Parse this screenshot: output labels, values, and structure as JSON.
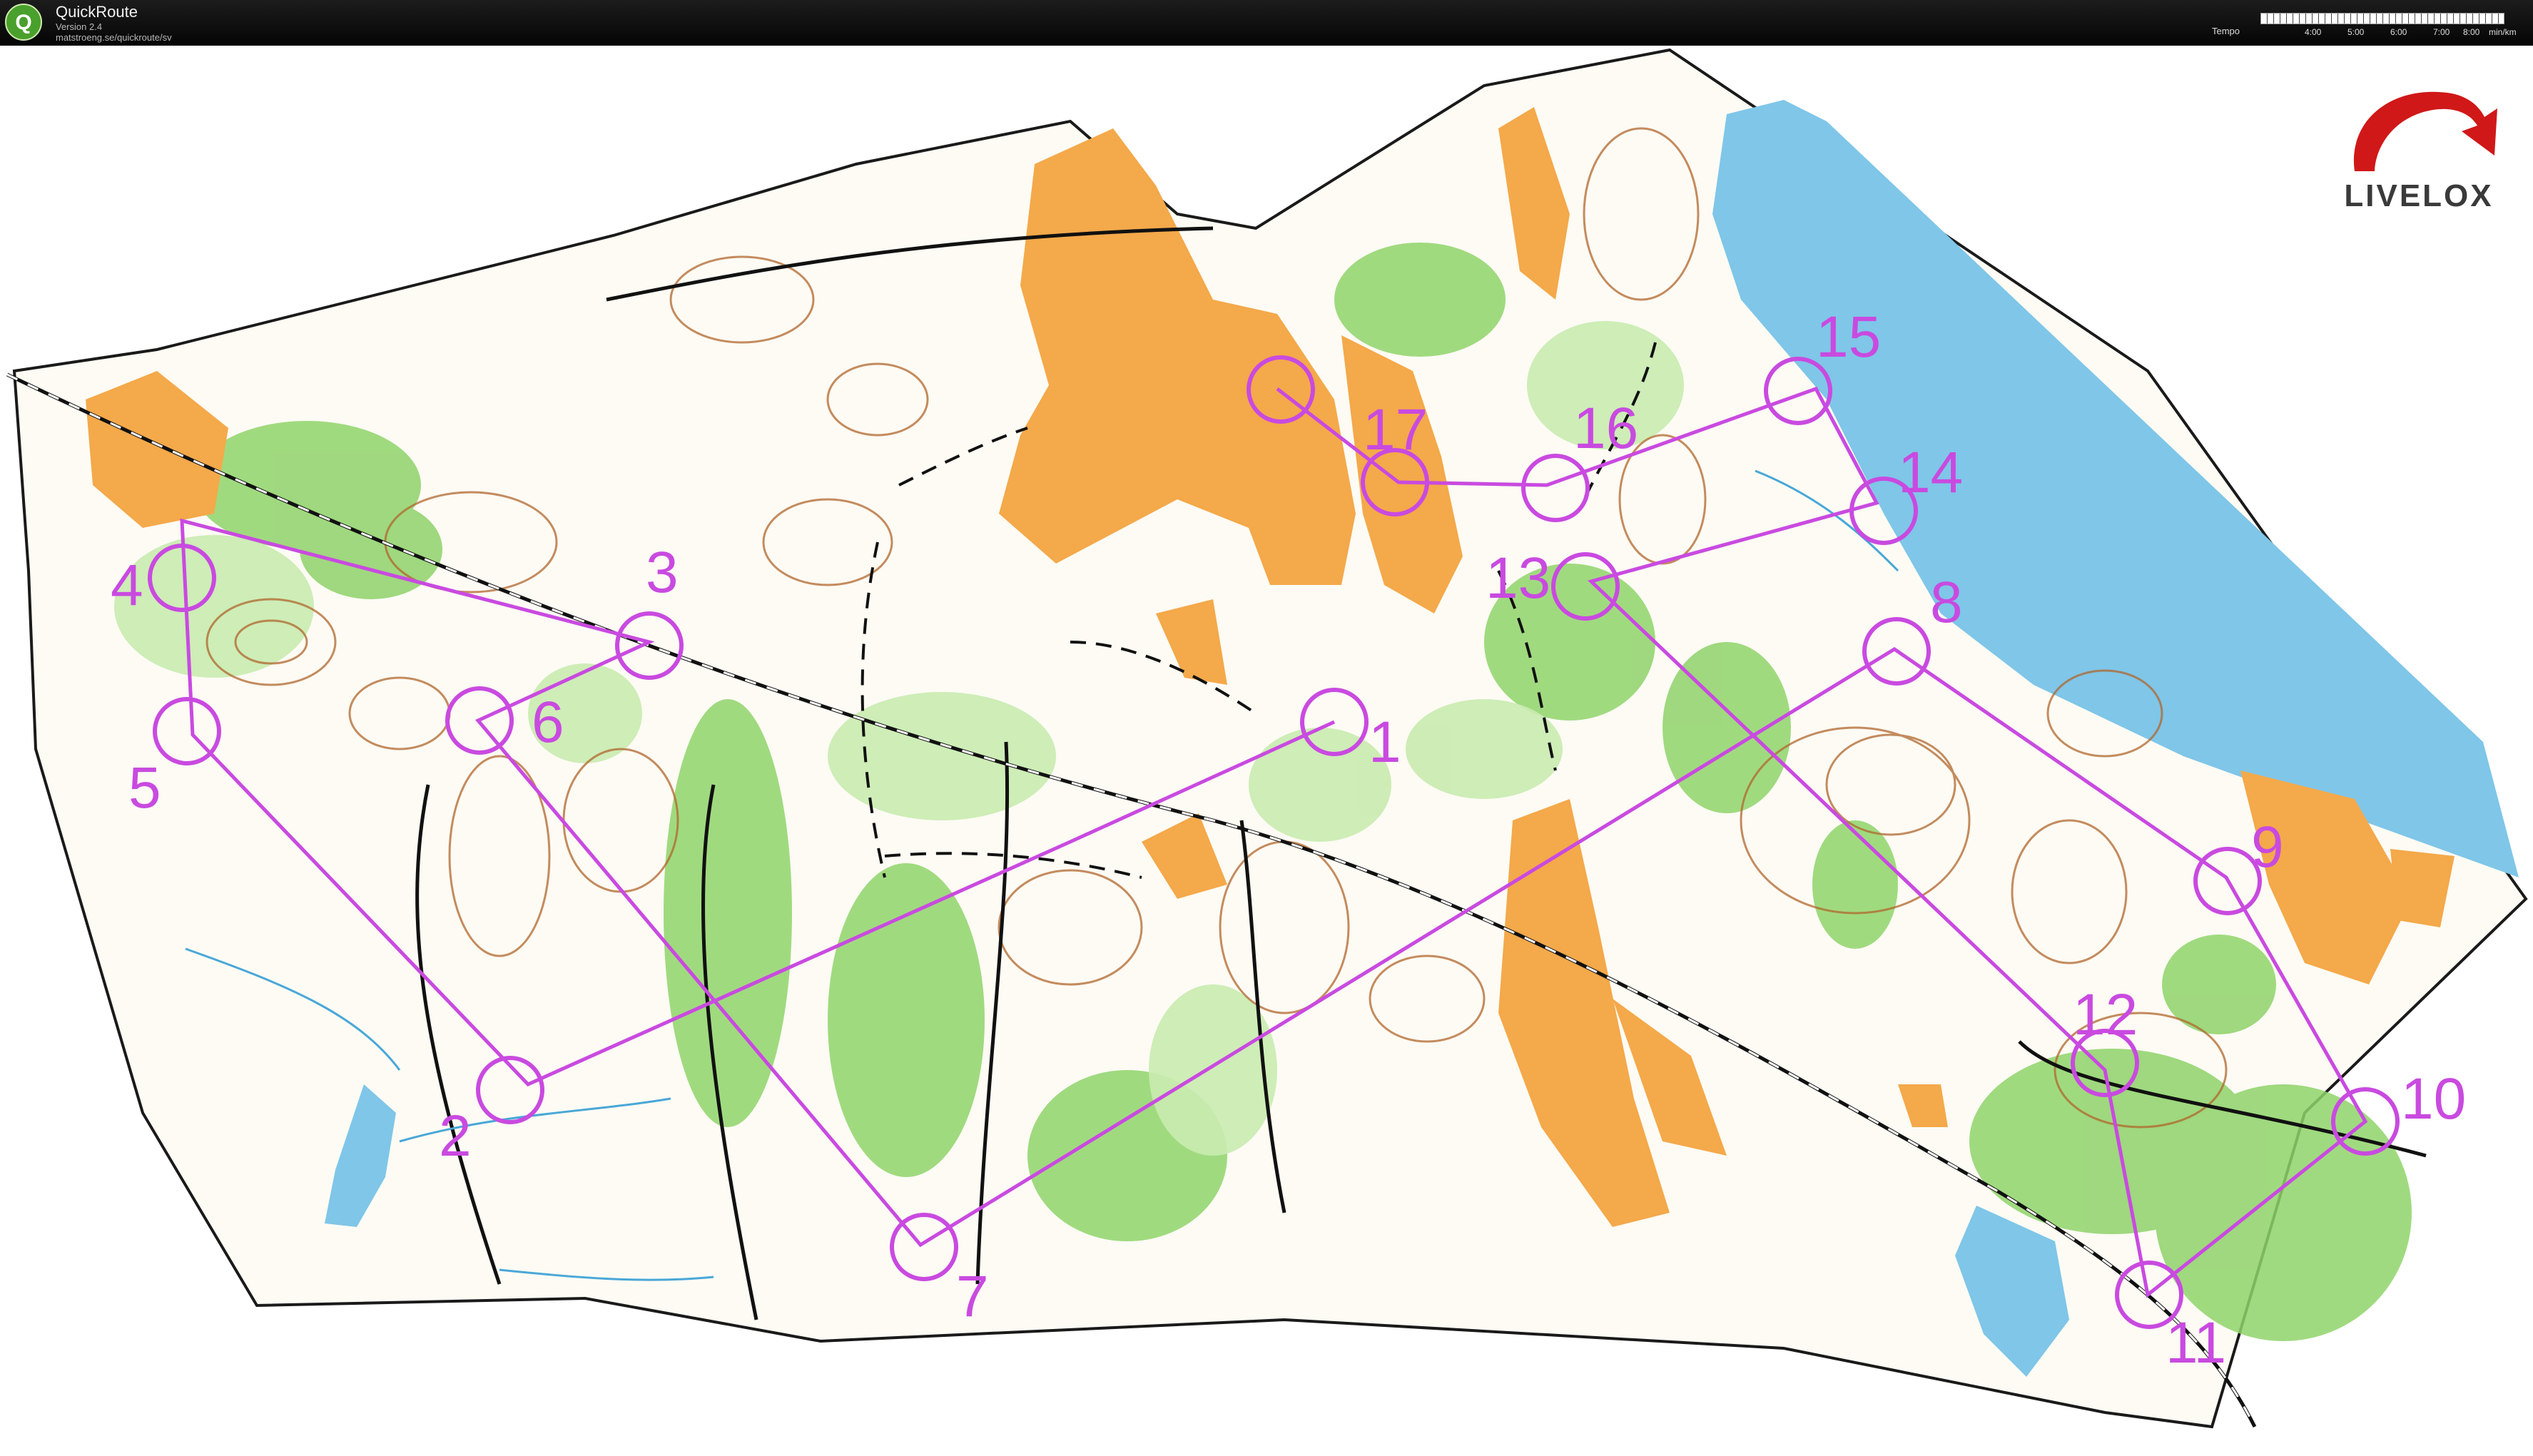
{
  "app": {
    "title": "QuickRoute",
    "version": "Version 2.4",
    "url": "matstroeng.se/quickroute/sv",
    "icon": "quickroute-q-icon"
  },
  "tempo_legend": {
    "label": "Tempo",
    "ticks": [
      "4:00",
      "5:00",
      "6:00",
      "7:00",
      "8:00"
    ],
    "unit": "min/km"
  },
  "brand": {
    "name": "LIVELOX",
    "logo_icon": "livelox-swoosh-icon",
    "colors": {
      "swoosh_red": "#d01818",
      "text": "#3a3a3a"
    }
  },
  "course": {
    "color": "#c94ae0",
    "controls": [
      "1",
      "2",
      "3",
      "4",
      "5",
      "6",
      "7",
      "8",
      "9",
      "10",
      "11",
      "12",
      "13",
      "14",
      "15",
      "16",
      "17"
    ]
  },
  "map_colors": {
    "open_land": "#f4a94a",
    "forest_green": "#8fd36a",
    "light_green": "#c9ebb0",
    "water": "#7fc6e8",
    "contours": "#b0662c",
    "road": "#111111"
  }
}
